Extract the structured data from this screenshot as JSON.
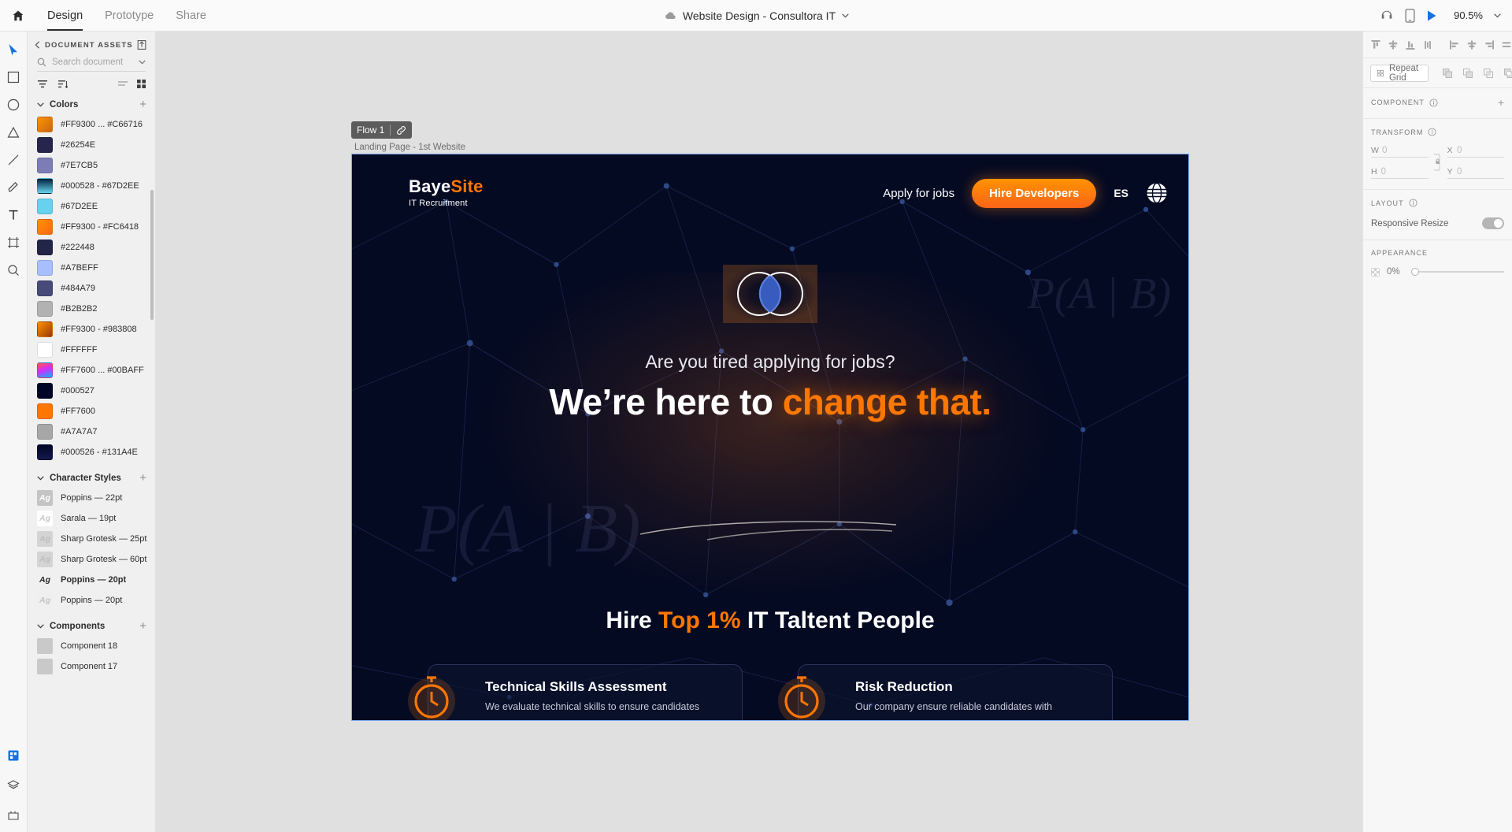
{
  "topbar": {
    "home_icon": "home-icon",
    "tabs": [
      {
        "label": "Design",
        "active": true
      },
      {
        "label": "Prototype",
        "active": false
      },
      {
        "label": "Share",
        "active": false
      }
    ],
    "cloud_icon": "cloud-icon",
    "doc_title": "Website Design - Consultora IT",
    "chevron_icon": "chevron-down-icon",
    "right_icons": [
      "headphones-icon",
      "device-preview-icon",
      "play-icon"
    ],
    "zoom_level": "90.5%",
    "zoom_chevron_icon": "chevron-down-icon"
  },
  "toolrail": {
    "tools": [
      {
        "name": "select-tool",
        "icon": "cursor-icon",
        "active": true
      },
      {
        "name": "rectangle-tool",
        "icon": "square-icon",
        "active": false
      },
      {
        "name": "ellipse-tool",
        "icon": "circle-icon",
        "active": false
      },
      {
        "name": "polygon-tool",
        "icon": "triangle-icon",
        "active": false
      },
      {
        "name": "line-tool",
        "icon": "line-icon",
        "active": false
      },
      {
        "name": "pen-tool",
        "icon": "pen-icon",
        "active": false
      },
      {
        "name": "text-tool",
        "icon": "text-icon",
        "active": false
      },
      {
        "name": "artboard-tool",
        "icon": "artboard-icon",
        "active": false
      },
      {
        "name": "zoom-tool",
        "icon": "magnifier-icon",
        "active": false
      }
    ],
    "bottom_tools": [
      {
        "name": "assets-panel-toggle",
        "icon": "assets-icon",
        "active": true
      },
      {
        "name": "layers-panel-toggle",
        "icon": "layers-icon",
        "active": false
      },
      {
        "name": "plugins-panel-toggle",
        "icon": "plugin-icon",
        "active": false
      }
    ]
  },
  "assets": {
    "back_icon": "chevron-left-icon",
    "title": "DOCUMENT ASSETS",
    "export_icon": "export-icon",
    "search": {
      "icon": "search-icon",
      "placeholder": "Search document",
      "value": "",
      "chevron_icon": "chevron-down-icon"
    },
    "filter_icons": [
      "filter-icon",
      "sort-icon"
    ],
    "view_icons": [
      "list-view-icon",
      "grid-view-icon"
    ],
    "sections": {
      "colors": {
        "title": "Colors",
        "collapse_icon": "chevron-down-icon",
        "add_icon": "plus-icon",
        "items": [
          {
            "label": "#FF9300 ... #C66716",
            "css": "linear-gradient(135deg,#FF9300,#C66716)"
          },
          {
            "label": "#26254E",
            "css": "#26254E"
          },
          {
            "label": "#7E7CB5",
            "css": "#7E7CB5"
          },
          {
            "label": "#000528 - #67D2EE",
            "css": "linear-gradient(180deg,#00203a,#67D2EE)"
          },
          {
            "label": "#67D2EE",
            "css": "#67D2EE"
          },
          {
            "label": "#FF9300 - #FC6418",
            "css": "linear-gradient(135deg,#FF9300,#FC6418)"
          },
          {
            "label": "#222448",
            "css": "#222448"
          },
          {
            "label": "#A7BEFF",
            "css": "#A7BEFF"
          },
          {
            "label": "#484A79",
            "css": "#484A79"
          },
          {
            "label": "#B2B2B2",
            "css": "#B2B2B2"
          },
          {
            "label": "#FF9300 - #983808",
            "css": "linear-gradient(135deg,#FF9300,#983808)"
          },
          {
            "label": "#FFFFFF",
            "css": "#FFFFFF"
          },
          {
            "label": "#FF7600 ... #00BAFF",
            "css": "linear-gradient(160deg,#FF5A3C,#D42BFF 45%,#00BAFF)"
          },
          {
            "label": "#000527",
            "css": "#000527"
          },
          {
            "label": "#FF7600",
            "css": "#FF7600"
          },
          {
            "label": "#A7A7A7",
            "css": "#A7A7A7"
          },
          {
            "label": "#000526 - #131A4E",
            "css": "linear-gradient(180deg,#000526,#131A4E)"
          }
        ]
      },
      "character_styles": {
        "title": "Character Styles",
        "collapse_icon": "chevron-down-icon",
        "add_icon": "plus-icon",
        "items": [
          {
            "label": "Poppins — 22pt",
            "swatch_bg": "#c4c4c4",
            "swatch_fg": "#ffffff",
            "bold": false
          },
          {
            "label": "Sarala — 19pt",
            "swatch_bg": "#ffffff",
            "swatch_fg": "#c9c9c9",
            "bold": false
          },
          {
            "label": "Sharp Grotesk — 25pt",
            "swatch_bg": "#d4d4d4",
            "swatch_fg": "#bfbfbf",
            "bold": false
          },
          {
            "label": "Sharp Grotesk — 60pt",
            "swatch_bg": "#d4d4d4",
            "swatch_fg": "#bfbfbf",
            "bold": false
          },
          {
            "label": "Poppins — 20pt",
            "swatch_bg": "#f0f0f0",
            "swatch_fg": "#2c2c2c",
            "bold": true
          },
          {
            "label": "Poppins — 20pt",
            "swatch_bg": "#efefef",
            "swatch_fg": "#c4c4c4",
            "bold": false
          }
        ]
      },
      "components": {
        "title": "Components",
        "collapse_icon": "chevron-down-icon",
        "add_icon": "plus-icon",
        "items": [
          {
            "label": "Component 18"
          },
          {
            "label": "Component 17"
          }
        ]
      }
    }
  },
  "canvas": {
    "flow_badge": {
      "label": "Flow 1",
      "link_icon": "link-icon"
    },
    "artboard_label": "Landing Page - 1st Website",
    "artboard": {
      "bg_color": "#040a22",
      "nav": {
        "logo_main": "Baye",
        "logo_accent": "Site",
        "logo_sub": "IT Recruitment",
        "link": "Apply for jobs",
        "cta": "Hire Developers",
        "lang": "ES",
        "globe_icon": "globe-icon"
      },
      "hero": {
        "venn_icon": "venn-diagram-icon",
        "subtitle": "Are you tired applying for jobs?",
        "title_part1": "We’re here to ",
        "title_accent": "change that",
        "title_period": "."
      },
      "section2": {
        "title_part1": "Hire ",
        "title_accent": "Top 1%",
        "title_part2": " IT Taltent People",
        "cards": [
          {
            "icon": "stopwatch-icon",
            "title": "Technical Skills Assessment",
            "desc": "We evaluate technical skills to ensure candidates"
          },
          {
            "icon": "stopwatch-icon",
            "title": "Risk Reduction",
            "desc": "Our company ensure reliable candidates with"
          }
        ]
      },
      "watermarks": [
        "P(A | B)",
        "P(A | B)"
      ]
    }
  },
  "props": {
    "align_buttons": [
      "align-top-icon",
      "align-vertical-center-icon",
      "align-bottom-icon",
      "distribute-vertical-icon",
      "align-left-icon",
      "align-horizontal-center-icon",
      "align-right-icon",
      "distribute-horizontal-icon"
    ],
    "repeat_grid": {
      "icon": "repeat-grid-icon",
      "label": "Repeat Grid"
    },
    "boolean_icons": [
      "boolean-add-icon",
      "boolean-subtract-icon",
      "boolean-intersect-icon",
      "boolean-exclude-icon"
    ],
    "component": {
      "label": "COMPONENT",
      "info_icon": "info-icon",
      "add_icon": "plus-icon"
    },
    "transform": {
      "label": "TRANSFORM",
      "info_icon": "info-icon",
      "w_key": "W",
      "w_value": "0",
      "x_key": "X",
      "x_value": "0",
      "h_key": "H",
      "h_value": "0",
      "y_key": "Y",
      "y_value": "0",
      "lock_icon": "lock-icon"
    },
    "layout": {
      "label": "LAYOUT",
      "info_icon": "info-icon",
      "responsive_resize_label": "Responsive Resize",
      "responsive_resize_on": false
    },
    "appearance": {
      "label": "APPEARANCE",
      "opacity_value": "0%",
      "checker_icon": "transparency-icon"
    }
  },
  "colors": {
    "accent_orange": "#FF7600",
    "accent_orange_light": "#FF9300",
    "xd_blue": "#1473e6",
    "artboard_bg": "#040a22"
  }
}
